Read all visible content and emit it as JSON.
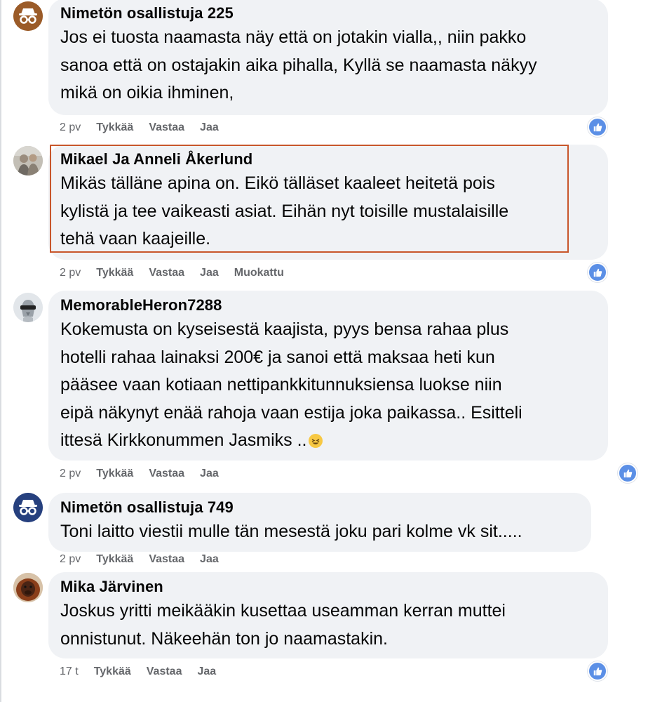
{
  "colors": {
    "bubble": "#f0f2f5",
    "meta_text": "#65676b",
    "like_blue": "#5b8fe6",
    "highlight": "#c8562b"
  },
  "comments": [
    {
      "author": "Nimetön osallistuja 225",
      "avatar": "anonymous-user-icon",
      "lines": [
        "Jos ei tuosta naamasta näy että on jotakin vialla,, niin pakko",
        "sanoa että on ostajakin aika pihalla, Kyllä se naamasta näkyy",
        "mikä on oikia ihminen,"
      ],
      "time": "2 pv",
      "like": "Tykkää",
      "reply": "Vastaa",
      "share": "Jaa"
    },
    {
      "author": "Mikael Ja Anneli Åkerlund",
      "avatar": "profile-photo",
      "lines": [
        "Mikäs tälläne apina on. Eikö tälläset kaaleet heitetä pois",
        "kylistä ja tee vaikeasti asiat. Eihän nyt toisille mustalaisille",
        "tehä vaan kaajeille."
      ],
      "time": "2 pv",
      "like": "Tykkää",
      "reply": "Vastaa",
      "share": "Jaa",
      "edited": "Muokattu"
    },
    {
      "author": "MemorableHeron7288",
      "avatar": "animal-avatar-icon",
      "lines": [
        "Kokemusta on kyseisestä kaajista, pyys bensa rahaa plus",
        "hotelli rahaa lainaksi 200€ ja sanoi että maksaa heti kun",
        "pääsee vaan kotiaan nettipankkitunnuksiensa luokse niin",
        "eipä näkynyt enää rahoja vaan estija joka paikassa.. Esitteli",
        "ittesä Kirkkonummen Jasmiks .."
      ],
      "time": "2 pv",
      "like": "Tykkää",
      "reply": "Vastaa",
      "share": "Jaa"
    },
    {
      "author": "Nimetön osallistuja 749",
      "avatar": "anonymous-user-icon",
      "lines": [
        "Toni laitto viestii mulle tän mesestä joku pari kolme vk sit....."
      ],
      "time": "2 pv",
      "like": "Tykkää",
      "reply": "Vastaa",
      "share": "Jaa"
    },
    {
      "author": "Mika Järvinen",
      "avatar": "orangutan-avatar",
      "lines": [
        "Joskus yritti meikääkin kusettaa useamman kerran muttei",
        "onnistunut. Näkeehän ton jo naamastakin."
      ],
      "time": "17 t",
      "like": "Tykkää",
      "reply": "Vastaa",
      "share": "Jaa"
    }
  ]
}
